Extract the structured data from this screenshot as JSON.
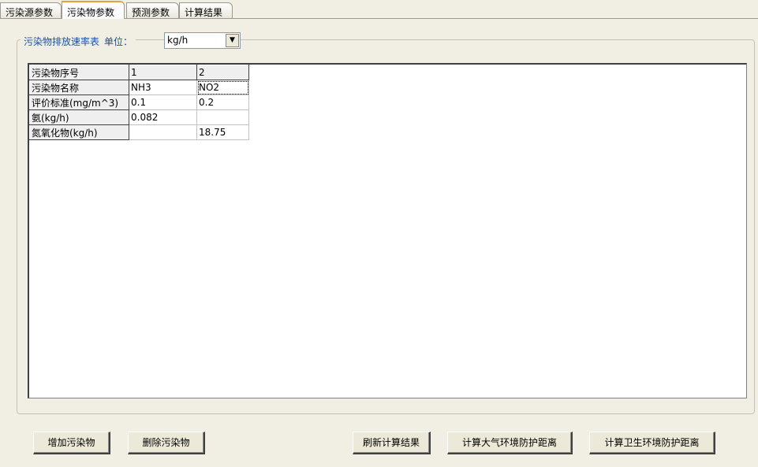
{
  "tabs": [
    "污染源参数",
    "污染物参数",
    "预测参数",
    "计算结果"
  ],
  "active_tab": "污染物参数",
  "group": {
    "title": "污染物排放速率表",
    "unit_label": "单位：",
    "unit_value": "kg/h"
  },
  "grid": {
    "rows": [
      {
        "label": "污染物序号",
        "c1": "1",
        "c2": "2"
      },
      {
        "label": "污染物名称",
        "c1": "NH3",
        "c2": "NO2"
      },
      {
        "label": "评价标准(mg/m^3)",
        "c1": "0.1",
        "c2": "0.2"
      },
      {
        "label": "氨(kg/h)",
        "c1": "0.082",
        "c2": ""
      },
      {
        "label": "氮氧化物(kg/h)",
        "c1": "",
        "c2": "18.75"
      }
    ]
  },
  "buttons": {
    "add": "增加污染物",
    "delete": "删除污染物",
    "refresh": "刷新计算结果",
    "atmos": "计算大气环境防护距离",
    "health": "计算卫生环境防护距离"
  },
  "colors": {
    "background": "#f1efe3",
    "active_tab_accent": "#e3a53a",
    "legend_text": "#1b4fa8"
  }
}
